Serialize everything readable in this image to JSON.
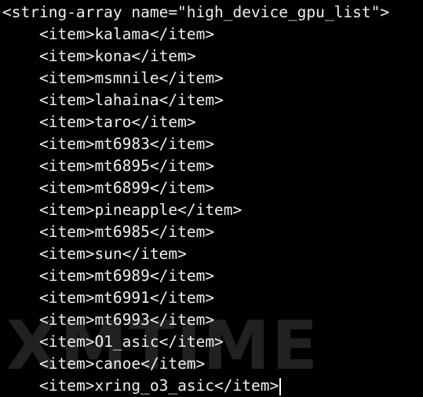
{
  "editor": {
    "open_tag": "<string-array name=\"high_device_gpu_list\">",
    "items": [
      "<item>kalama</item>",
      "<item>kona</item>",
      "<item>msmnile</item>",
      "<item>lahaina</item>",
      "<item>taro</item>",
      "<item>mt6983</item>",
      "<item>mt6895</item>",
      "<item>mt6899</item>",
      "<item>pineapple</item>",
      "<item>mt6985</item>",
      "<item>sun</item>",
      "<item>mt6989</item>",
      "<item>mt6991</item>",
      "<item>mt6993</item>",
      "<item>O1_asic</item>",
      "<item>canoe</item>",
      "<item>xring_o3_asic</item>"
    ]
  },
  "watermark": {
    "text": "XMTIME"
  },
  "colors": {
    "background": "#000000",
    "text": "#f0f0f0"
  }
}
